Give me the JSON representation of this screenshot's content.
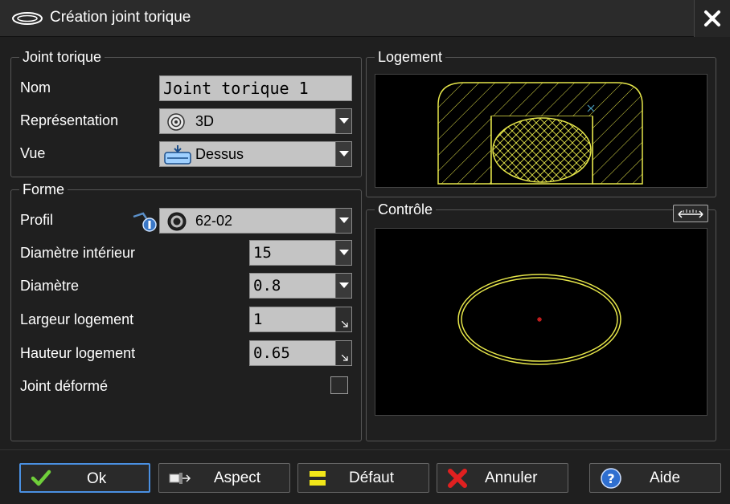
{
  "window": {
    "title": "Création joint torique"
  },
  "joint_torique": {
    "group_title": "Joint torique",
    "nom_label": "Nom",
    "nom_value": "Joint torique 1",
    "representation_label": "Représentation",
    "representation_value": "3D",
    "vue_label": "Vue",
    "vue_value": "Dessus"
  },
  "forme": {
    "group_title": "Forme",
    "profil_label": "Profil",
    "profil_value": "62-02",
    "diametre_interieur_label": "Diamètre intérieur",
    "diametre_interieur_value": "15",
    "diametre_label": "Diamètre",
    "diametre_value": "0.8",
    "largeur_logement_label": "Largeur logement",
    "largeur_logement_value": "1",
    "hauteur_logement_label": "Hauteur logement",
    "hauteur_logement_value": "0.65",
    "joint_deforme_label": "Joint déformé",
    "joint_deforme_checked": false
  },
  "logement": {
    "group_title": "Logement"
  },
  "controle": {
    "group_title": "Contrôle"
  },
  "buttons": {
    "ok": "Ok",
    "aspect": "Aspect",
    "defaut": "Défaut",
    "annuler": "Annuler",
    "aide": "Aide"
  },
  "colors": {
    "accent": "#4a90e2",
    "drawing_stroke": "#e6e64a",
    "center_mark": "#d02020",
    "axis_mark": "#4aa0c0",
    "field_bg": "#c4c4c4"
  },
  "icons": {
    "title": "o-ring-icon",
    "close": "close-icon",
    "representation": "target-3d-icon",
    "vue": "top-view-icon",
    "profil": "o-ring-profile-icon",
    "profil_tool": "measure-tool-icon",
    "controle_tool": "ruler-icon",
    "ok": "checkmark-icon",
    "aspect": "aspect-icon",
    "defaut": "default-icon",
    "annuler": "cancel-x-icon",
    "aide": "help-icon"
  }
}
